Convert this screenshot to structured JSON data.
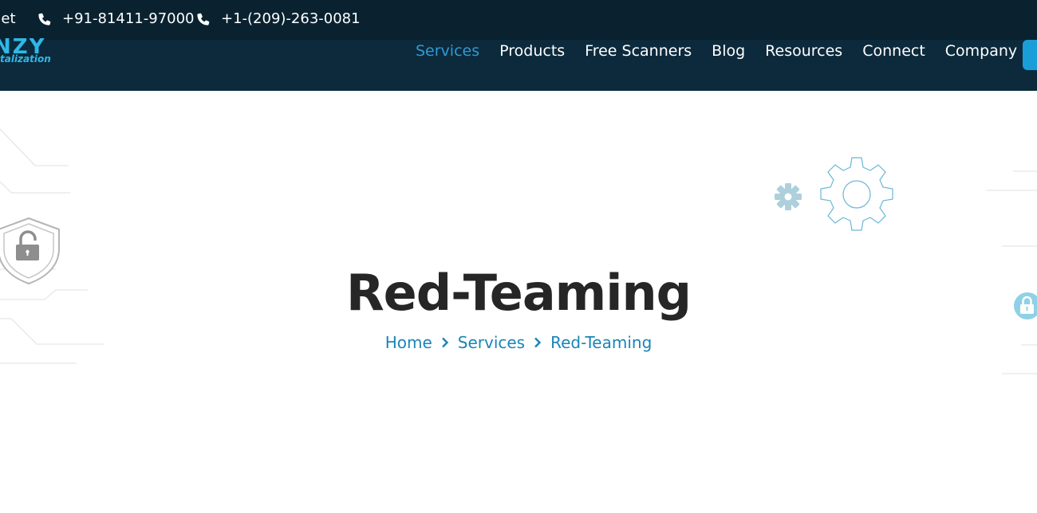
{
  "topbar": {
    "email_fragment": "net",
    "phones": [
      "+91-81411-97000",
      "+1-(209)-263-0081"
    ]
  },
  "logo": {
    "mark": "NZY",
    "sub": "talization"
  },
  "nav": {
    "items": [
      {
        "label": "Services",
        "active": true
      },
      {
        "label": "Products",
        "active": false
      },
      {
        "label": "Free Scanners",
        "active": false
      },
      {
        "label": "Blog",
        "active": false
      },
      {
        "label": "Resources",
        "active": false
      },
      {
        "label": "Connect",
        "active": false
      },
      {
        "label": "Company",
        "active": false
      }
    ]
  },
  "hero": {
    "title": "Red-Teaming",
    "breadcrumb": [
      "Home",
      "Services",
      "Red-Teaming"
    ]
  },
  "colors": {
    "topbar_bg": "#0a2230",
    "navbar_bg": "#0c2a3c",
    "accent": "#2e9ad4",
    "title": "#262626",
    "breadcrumb": "#1a84b8"
  },
  "icons": [
    "phone-icon",
    "chevron-right-icon",
    "shield-lock-icon",
    "gear-icon",
    "lock-icon"
  ]
}
